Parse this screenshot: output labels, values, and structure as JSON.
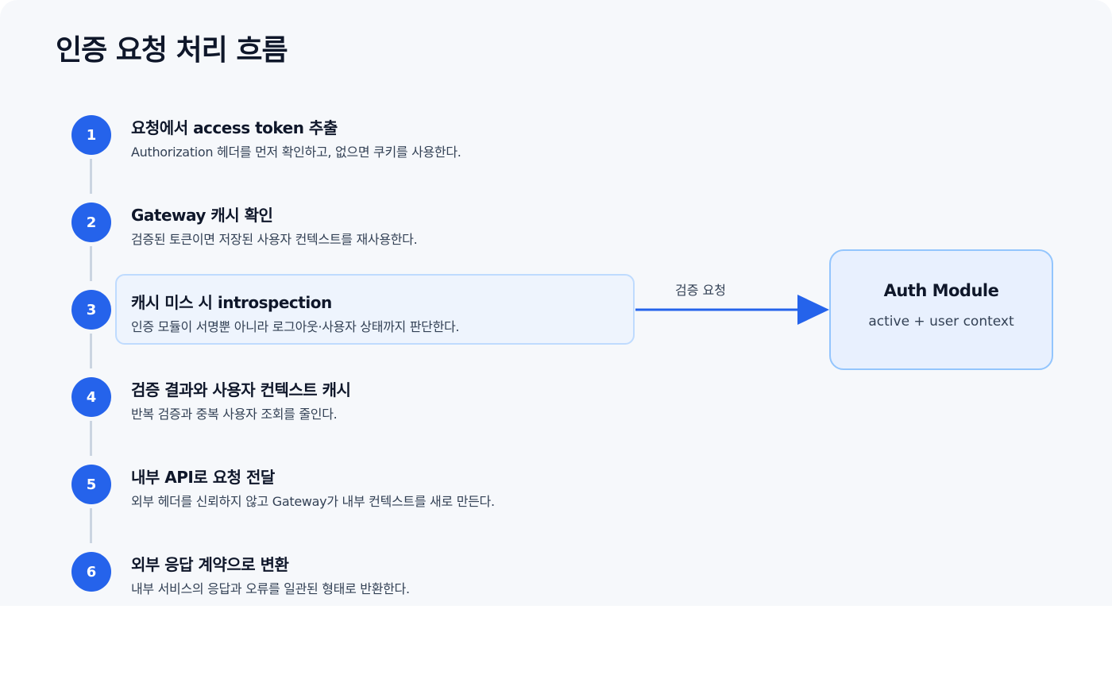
{
  "title": "인증 요청 처리 흐름",
  "steps": [
    {
      "number": "1",
      "title": "요청에서 access token 추출",
      "description": "Authorization 헤더를 먼저 확인하고, 없으면 쿠키를 사용한다."
    },
    {
      "number": "2",
      "title": "Gateway 캐시 확인",
      "description": "검증된 토큰이면 저장된 사용자 컨텍스트를 재사용한다."
    },
    {
      "number": "3",
      "title": "캐시 미스 시 introspection",
      "description": "인증 모듈이 서명뿐 아니라 로그아웃·사용자 상태까지 판단한다."
    },
    {
      "number": "4",
      "title": "검증 결과와 사용자 컨텍스트 캐시",
      "description": "반복 검증과 중복 사용자 조회를 줄인다."
    },
    {
      "number": "5",
      "title": "내부 API로 요청 전달",
      "description": "외부 헤더를 신뢰하지 않고 Gateway가 내부 컨텍스트를 새로 만든다."
    },
    {
      "number": "6",
      "title": "외부 응답 계약으로 변환",
      "description": "내부 서비스의 응답과 오류를 일관된 형태로 반환한다."
    }
  ],
  "edge": {
    "label": "검증 요청"
  },
  "auth_module": {
    "title": "Auth Module",
    "subtitle": "active + user context"
  },
  "colors": {
    "accent": "#2563eb",
    "highlight_fill": "#eef4fd",
    "highlight_border": "#bfdbfe",
    "module_fill": "#e8f0fe",
    "module_border": "#93c5fd",
    "connector": "#cbd5e1"
  }
}
